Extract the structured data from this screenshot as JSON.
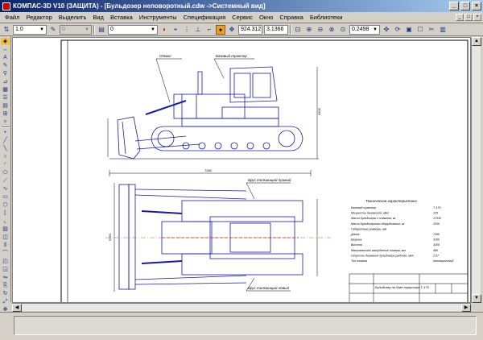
{
  "window": {
    "title": "КОМПАС-3D V10 (ЗАЩИТА) - [Бульдозер неповоротный.cdw ->Системный вид]",
    "minimize": "_",
    "maximize": "□",
    "close": "×"
  },
  "menu": {
    "items": [
      "Файл",
      "Редактор",
      "Выделить",
      "Вид",
      "Вставка",
      "Инструменты",
      "Спецификация",
      "Сервис",
      "Окно",
      "Справка",
      "Библиотеки"
    ]
  },
  "toolbar": {
    "line_width": "1.0",
    "layer_value": "0",
    "coord_x": "924.312",
    "coord_y": "3.1366",
    "zoom": "0.2498",
    "disabled_field": "0"
  },
  "drawing": {
    "label_otval": "Отвал",
    "label_base_tractor_top": "Базовый трактор",
    "label_base_tractor_mid": "Брус толкающий правый",
    "label_base_tractor_bot": "Брус толкающий левый",
    "tech_title": "Техническая характеристика",
    "tech_rows": [
      {
        "label": "Базовый трактор",
        "value": "Т-170"
      },
      {
        "label": "Мощность двигателя, кВт",
        "value": "125"
      },
      {
        "label": "Масса бульдозера с отвалом, кг",
        "value": "17330"
      },
      {
        "label": "Масса бульдозерного оборудования, кг",
        "value": "1530"
      },
      {
        "label": "Габаритные размеры, мм",
        "value": ""
      },
      {
        "label": "Длина",
        "value": "7260"
      },
      {
        "label": "Ширина",
        "value": "3160"
      },
      {
        "label": "Высота",
        "value": "3200"
      },
      {
        "label": "Максимальное заглубление отвала, мм",
        "value": "460"
      },
      {
        "label": "Скорость движения бульдозера рабочая, км/ч",
        "value": "2.57"
      },
      {
        "label": "Тип отвала",
        "value": "неповоротный"
      }
    ],
    "stamp_title": "Бульдозер на базе трактора Т-170",
    "dim_length": "7260",
    "dim_height": "3200",
    "dim_width": "3160"
  }
}
